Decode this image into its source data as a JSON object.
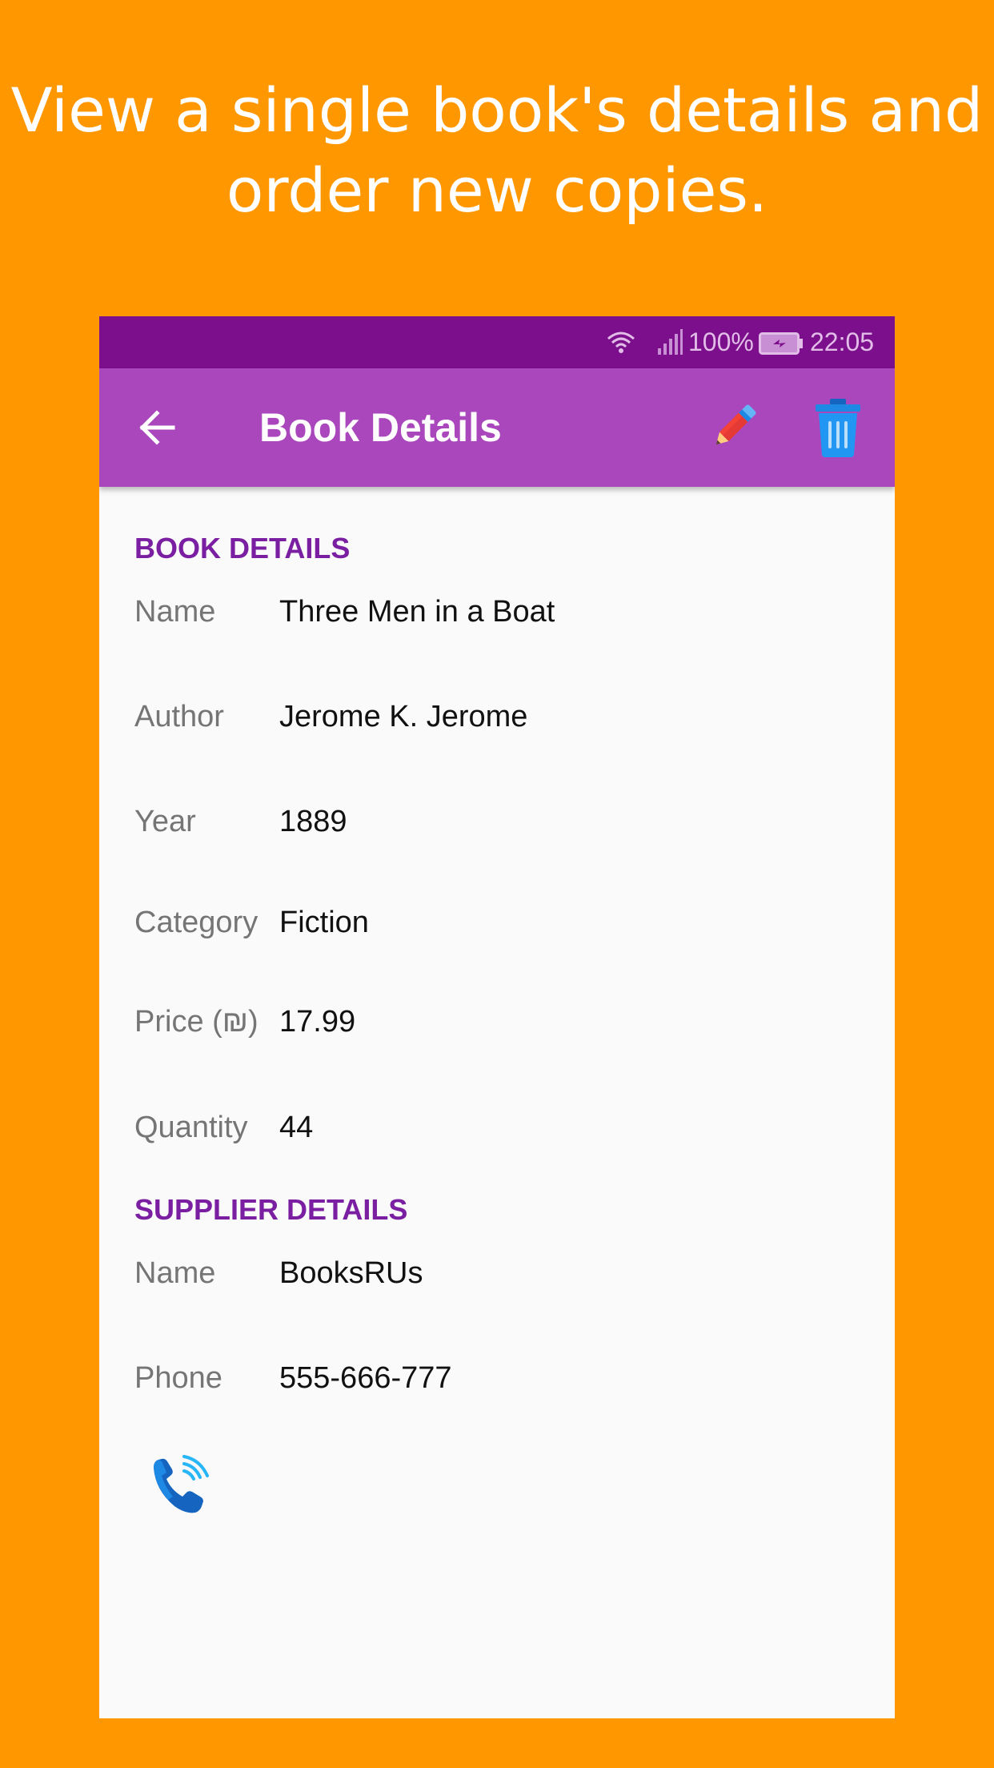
{
  "promo": {
    "line1": "View a single book's details and",
    "line2": "order new copies."
  },
  "status_bar": {
    "battery": "100%",
    "time": "22:05",
    "icons": [
      "wifi-icon",
      "signal-icon",
      "battery-charging-icon"
    ]
  },
  "app_bar": {
    "title": "Book Details",
    "icons": [
      "back-arrow-icon",
      "pencil-icon",
      "trash-icon"
    ]
  },
  "book_section": {
    "header": "BOOK DETAILS",
    "rows": [
      {
        "label": "Name",
        "value": "Three Men in a Boat"
      },
      {
        "label": "Author",
        "value": "Jerome K. Jerome"
      },
      {
        "label": "Year",
        "value": "1889"
      },
      {
        "label": "Category",
        "value": "Fiction"
      },
      {
        "label": "Price (₪)",
        "value": "17.99"
      },
      {
        "label": "Quantity",
        "value": "44"
      }
    ]
  },
  "supplier_section": {
    "header": "SUPPLIER DETAILS",
    "rows": [
      {
        "label": "Name",
        "value": "BooksRUs"
      },
      {
        "label": "Phone",
        "value": "555-666-777"
      }
    ]
  },
  "call_button": {
    "icon": "phone-call-icon"
  },
  "colors": {
    "background": "#FF9800",
    "status_bar": "#7B0F8C",
    "app_bar": "#AB47BC",
    "section_header": "#7B1FA2",
    "screen": "#FAFAFA"
  }
}
